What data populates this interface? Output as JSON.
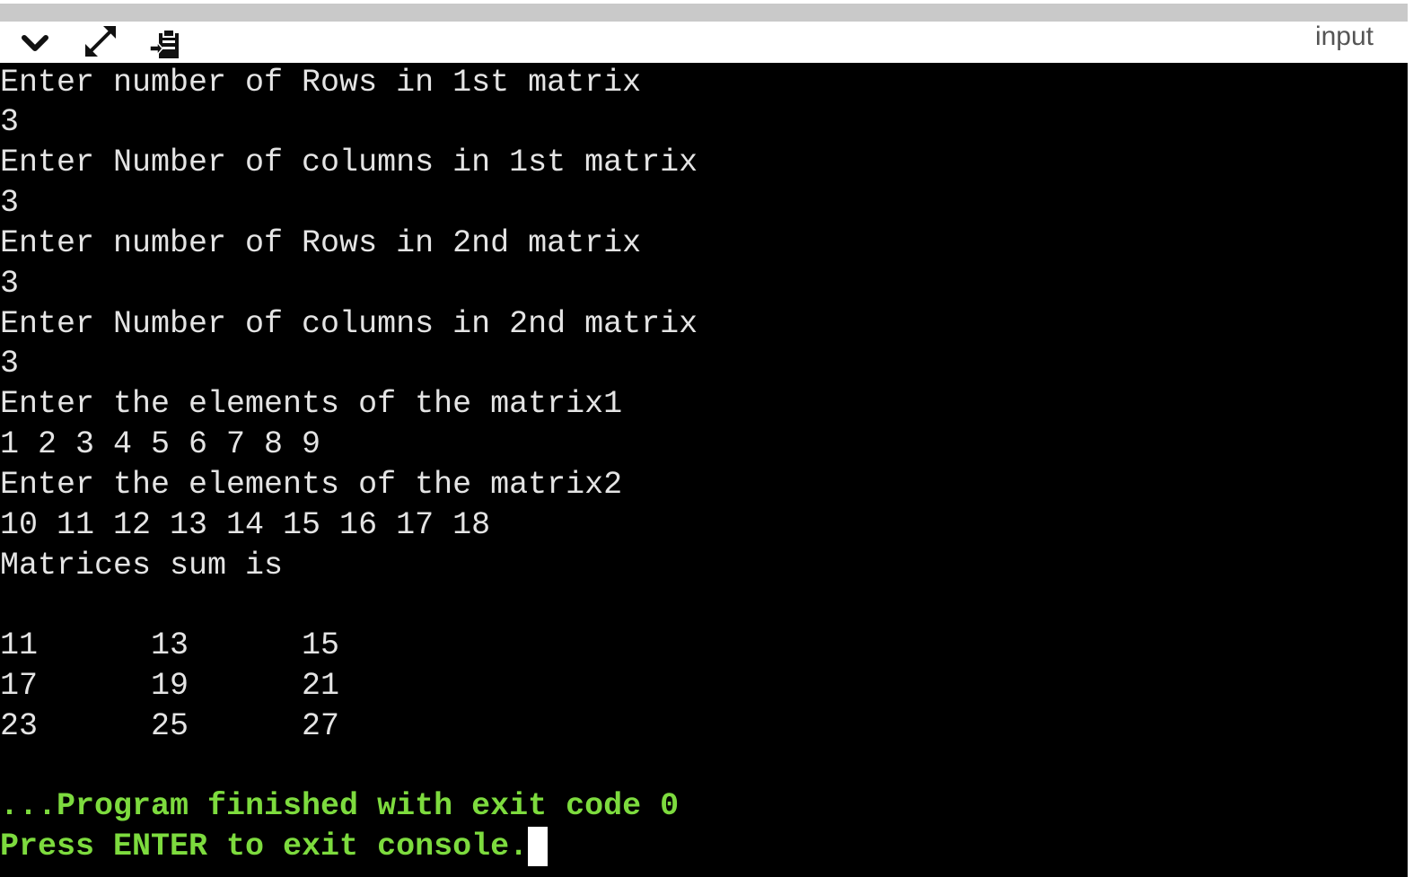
{
  "toolbar": {
    "collapse_icon": "chevron-down-icon",
    "expand_icon": "expand-arrows-icon",
    "copy_icon": "clipboard-icon",
    "input_tab_label": "input"
  },
  "console": {
    "lines": [
      "Enter number of Rows in 1st matrix",
      "3",
      "Enter Number of columns in 1st matrix",
      "3",
      "Enter number of Rows in 2nd matrix",
      "3",
      "Enter Number of columns in 2nd matrix",
      "3",
      "Enter the elements of the matrix1",
      "1 2 3 4 5 6 7 8 9",
      "Enter the elements of the matrix2",
      "10 11 12 13 14 15 16 17 18",
      "Matrices sum is",
      "",
      "11      13      15",
      "17      19      21",
      "23      25      27",
      ""
    ],
    "exit_message": "...Program finished with exit code 0",
    "press_enter_message": "Press ENTER to exit console."
  },
  "colors": {
    "console_background": "#000000",
    "console_text": "#e4e4e4",
    "status_text": "#7ddb3e",
    "toolbar_background": "#ffffff",
    "top_strip": "#c9c9c9"
  }
}
